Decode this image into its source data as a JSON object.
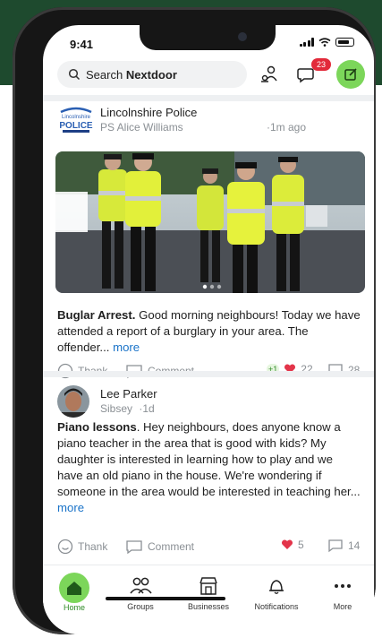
{
  "status": {
    "time": "9:41"
  },
  "search": {
    "prefix": "Search ",
    "brand": "Nextdoor"
  },
  "header": {
    "messages_badge": "23"
  },
  "posts": [
    {
      "logo_text": [
        "Lincolnshire",
        "POLICE"
      ],
      "author": "Lincolnshire Police",
      "sub_author": "PS Alice Williams",
      "time": "·1m ago",
      "title": "Buglar Arrest.",
      "body": " Good morning neighbours! Today we have attended a report of a burglary in your area. The offender...",
      "more": "more",
      "thank": "Thank",
      "comment": "Comment",
      "reactions_plus": "+1",
      "likes": "22",
      "comments": "28"
    },
    {
      "author": "Lee Parker",
      "location": "Sibsey",
      "time": "·1d",
      "title": "Piano lessons",
      "body": ". Hey neighbours, does anyone know a piano teacher in the area that is good with kids? My daughter is interested in learning how to play and we have an old piano in the house. We're wondering if someone in the area would be interested in teaching her...",
      "more": "more",
      "thank": "Thank",
      "comment": "Comment",
      "likes": "5",
      "comments": "14"
    }
  ],
  "tabs": [
    {
      "label": "Home",
      "icon": "home-icon"
    },
    {
      "label": "Groups",
      "icon": "groups-icon"
    },
    {
      "label": "Businesses",
      "icon": "store-icon"
    },
    {
      "label": "Notifications",
      "icon": "bell-icon"
    },
    {
      "label": "More",
      "icon": "more-dots-icon"
    }
  ],
  "colors": {
    "brand_green": "#7cd65a",
    "link_blue": "#1a73c8",
    "heart_red": "#e3344a",
    "badge_red": "#e22a3a"
  }
}
